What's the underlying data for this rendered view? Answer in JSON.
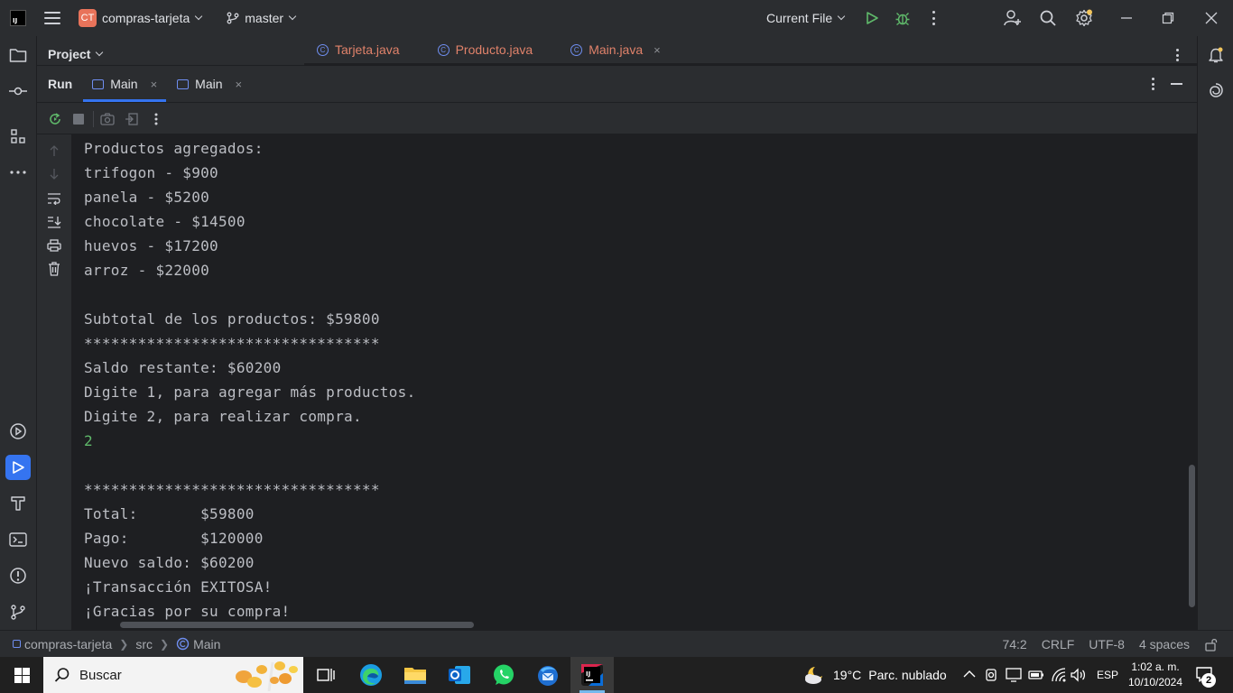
{
  "titlebar": {
    "project_badge": "CT",
    "project_name": "compras-tarjeta",
    "branch": "master",
    "run_config": "Current File"
  },
  "project_panel": {
    "title": "Project"
  },
  "editor_tabs": [
    {
      "label": "Tarjeta.java"
    },
    {
      "label": "Producto.java"
    },
    {
      "label": "Main.java",
      "close": "×"
    }
  ],
  "run_panel": {
    "title": "Run",
    "tabs": [
      {
        "label": "Main",
        "close": "×"
      },
      {
        "label": "Main",
        "close": "×"
      }
    ]
  },
  "console": {
    "lines": [
      "Productos agregados:",
      "trifogon - $900",
      "panela - $5200",
      "chocolate - $14500",
      "huevos - $17200",
      "arroz - $22000",
      "",
      "Subtotal de los productos: $59800",
      "*********************************",
      "Saldo restante: $60200",
      "Digite 1, para agregar más productos.",
      "Digite 2, para realizar compra.",
      "2",
      "",
      "*********************************",
      "Total:       $59800",
      "Pago:        $120000",
      "Nuevo saldo: $60200",
      "¡Transacción EXITOSA!",
      "¡Gracias por su compra!"
    ],
    "input_line_index": 12
  },
  "statusbar": {
    "breadcrumb": [
      "compras-tarjeta",
      "src",
      "Main"
    ],
    "position": "74:2",
    "line_ending": "CRLF",
    "encoding": "UTF-8",
    "indent": "4 spaces"
  },
  "taskbar": {
    "search_placeholder": "Buscar",
    "weather_temp": "19°C",
    "weather_desc": "Parc. nublado",
    "language": "ESP",
    "time": "1:02 a. m.",
    "date": "10/10/2024",
    "notifications": "2"
  },
  "colors": {
    "accent": "#3574f0",
    "console_input": "#5fb86a",
    "project_badge": "#e8735a",
    "tab_text_modified": "#e0826a",
    "run_green": "#5fb86a"
  }
}
